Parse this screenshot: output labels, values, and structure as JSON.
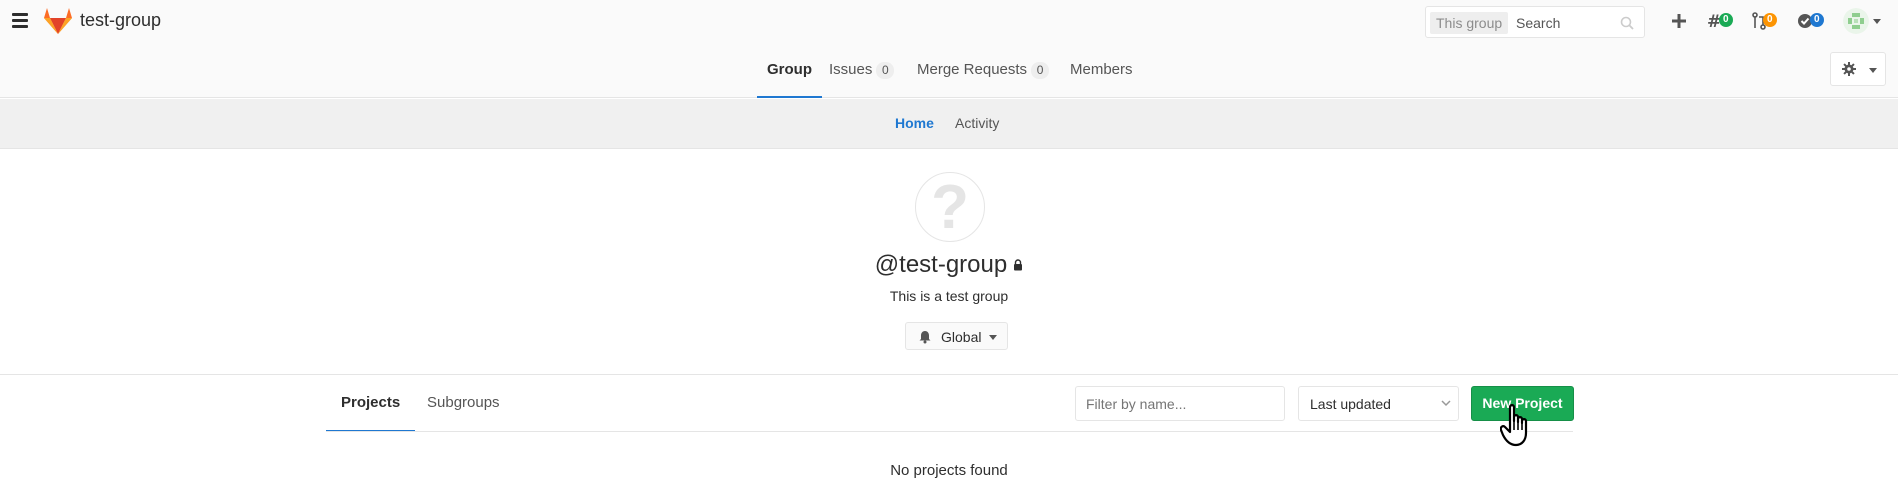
{
  "navbar": {
    "group_name": "test-group",
    "search_scope": "This group",
    "search_placeholder": "Search",
    "badges": {
      "issues": "0",
      "merge_requests": "0",
      "todos": "0"
    }
  },
  "group_tabs": [
    {
      "label": "Group",
      "count": null,
      "active": true
    },
    {
      "label": "Issues",
      "count": "0",
      "active": false
    },
    {
      "label": "Merge Requests",
      "count": "0",
      "active": false
    },
    {
      "label": "Members",
      "count": null,
      "active": false
    }
  ],
  "sub_nav": [
    {
      "label": "Home",
      "active": true
    },
    {
      "label": "Activity",
      "active": false
    }
  ],
  "group": {
    "avatar_glyph": "?",
    "title": "@test-group",
    "description": "This is a test group",
    "notification_level": "Global"
  },
  "projects": {
    "tabs": [
      "Projects",
      "Subgroups"
    ],
    "filter_placeholder": "Filter by name...",
    "sort_label": "Last updated",
    "new_project_label": "New Project",
    "empty_message": "No projects found"
  },
  "colors": {
    "accent_blue": "#1f78d1",
    "success_green": "#1aaa55",
    "issues_badge": "#1aaa55",
    "mr_badge": "#fc9403",
    "todo_badge": "#1f78d1"
  }
}
